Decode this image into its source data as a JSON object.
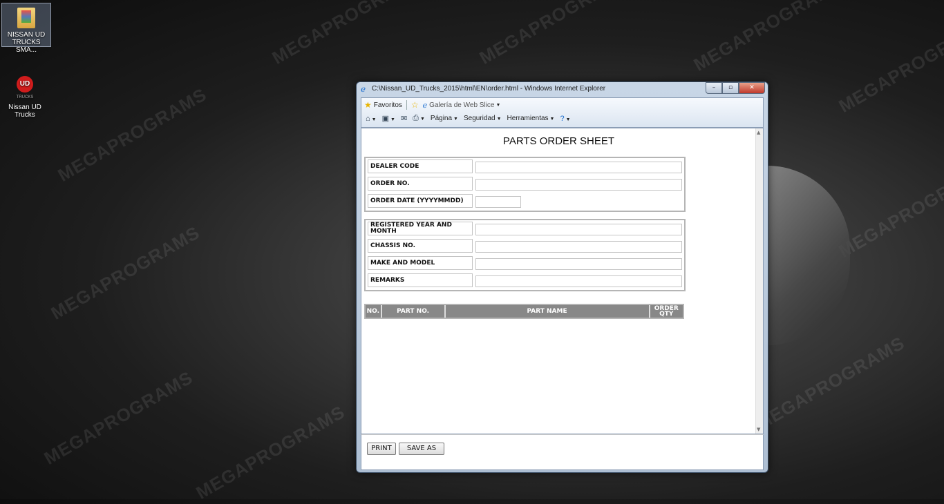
{
  "desktop": {
    "icons": [
      {
        "label": "NISSAN UD TRUCKS SMA..."
      },
      {
        "label": "Nissan UD Trucks",
        "sub": "TRUCKS"
      }
    ],
    "watermark": "MEGAPROGRAMS"
  },
  "window": {
    "title": "C:\\Nissan_UD_Trucks_2015\\html\\EN\\order.html - Windows Internet Explorer",
    "buttons": {
      "minimize": "–",
      "maximize": "▫",
      "close": "✕"
    }
  },
  "toolbar": {
    "favorites": "Favoritos",
    "web_slice": "Galería de Web Slice",
    "page": "Página",
    "security": "Seguridad",
    "tools": "Herramientas"
  },
  "form": {
    "title": "PARTS ORDER SHEET",
    "section1": [
      {
        "label": "DEALER CODE"
      },
      {
        "label": "ORDER NO."
      },
      {
        "label": "ORDER DATE (YYYYMMDD)"
      }
    ],
    "section2": [
      {
        "label": "REGISTERED YEAR AND MONTH"
      },
      {
        "label": "CHASSIS NO."
      },
      {
        "label": "MAKE AND MODEL"
      },
      {
        "label": "REMARKS"
      }
    ],
    "table_headers": [
      "NO.",
      "PART NO.",
      "PART NAME",
      "ORDER QTY"
    ]
  },
  "actions": {
    "print": "PRINT",
    "save_as": "SAVE AS"
  }
}
